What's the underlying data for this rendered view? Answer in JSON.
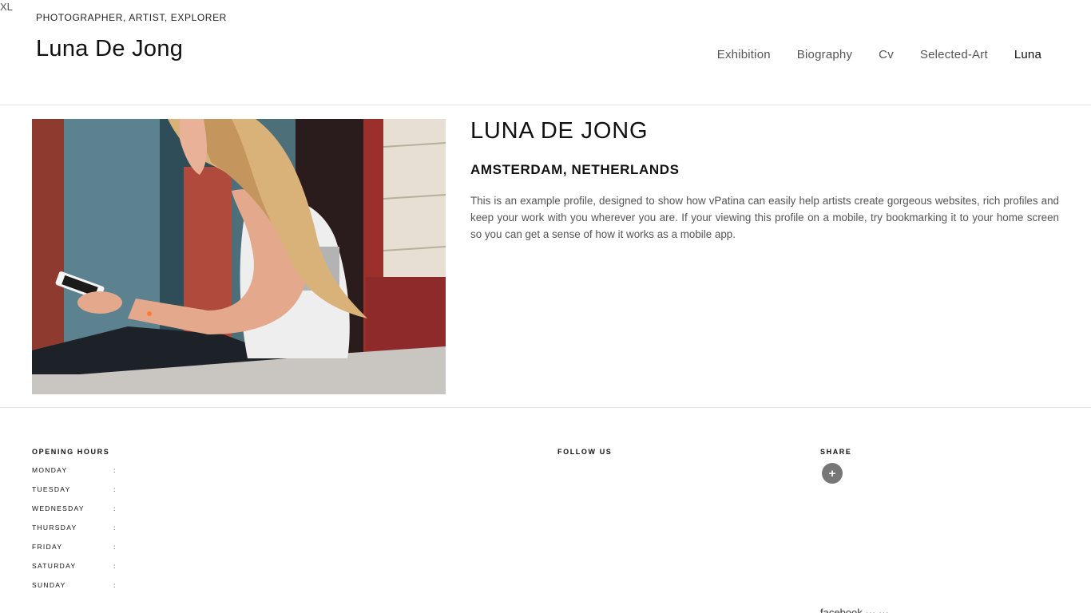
{
  "corner_tag": "XL",
  "header": {
    "tagline": "PHOTOGRAPHER, ARTIST, EXPLORER",
    "site_title": "Luna De Jong"
  },
  "nav": {
    "items": [
      {
        "label": "Exhibition"
      },
      {
        "label": "Biography"
      },
      {
        "label": "Cv"
      },
      {
        "label": "Selected-Art"
      },
      {
        "label": "Luna",
        "active": true
      }
    ]
  },
  "profile": {
    "name": "LUNA DE JONG",
    "location": "AMSTERDAM, NETHERLANDS",
    "bio": "This is an example profile, designed to show how vPatina can easily help artists create gorgeous websites, rich profiles and keep your work with you wherever you are. If your viewing this profile on a mobile, try bookmarking it to your home screen so you can get a sense of how it works as a mobile app.",
    "photo_icon": "profile-photo"
  },
  "footer": {
    "opening_hours": {
      "heading": "OPENING HOURS",
      "separator": ":",
      "days": [
        "MONDAY",
        "TUESDAY",
        "WEDNESDAY",
        "THURSDAY",
        "FRIDAY",
        "SATURDAY",
        "SUNDAY"
      ]
    },
    "follow_heading": "FOLLOW US",
    "share": {
      "heading": "SHARE",
      "button_glyph": "+",
      "icon": "plus-icon"
    },
    "cutoff_text": "facebook   ···   ···"
  }
}
